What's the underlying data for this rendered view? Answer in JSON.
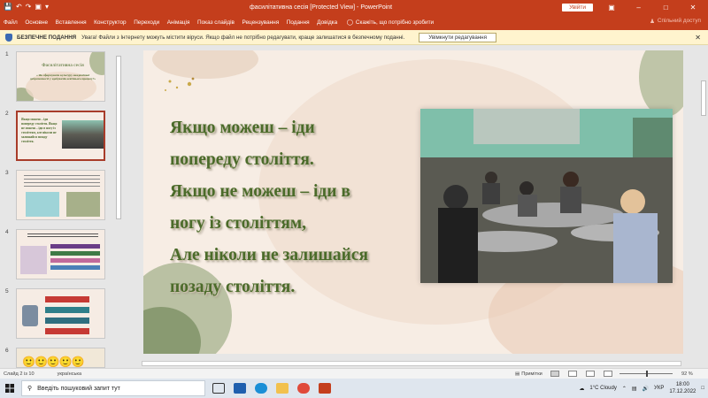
{
  "titlebar": {
    "title": "фасилітативна сесія [Protected View]  -  PowerPoint",
    "signin": "Увійти",
    "save_icon": "save-icon",
    "undo_icon": "undo-icon",
    "redo_icon": "redo-icon",
    "start_icon": "present-icon",
    "customize_icon": "customize-icon"
  },
  "ribbon": {
    "tabs": [
      "Файл",
      "Основне",
      "Вставлення",
      "Конструктор",
      "Переходи",
      "Анімація",
      "Показ слайдів",
      "Рецензування",
      "Подання",
      "Довідка"
    ],
    "tell_me": "Скажіть, що потрібно зробити",
    "share": "Спільний доступ"
  },
  "protected": {
    "title": "БЕЗПЕЧНЕ ПОДАННЯ",
    "message": "Увага! Файли з Інтернету можуть містити віруси. Якщо файл не потрібно редагувати, краще залишатися в безпечному поданні.",
    "button": "Увімкнути редагування"
  },
  "thumbnails": [
    {
      "num": "1",
      "title": "Фасилітативна сесія",
      "sub": "« Як сформувати культуру академічної доброчесності у здобувачів освітнього процесу?»"
    },
    {
      "num": "2",
      "text": "Якщо можеш – іди попереду століття. Якщо не можеш – іди в ногу із століттям, але ніколи не залишайся позаду століття."
    },
    {
      "num": "3",
      "text": ""
    },
    {
      "num": "4",
      "text": ""
    },
    {
      "num": "5",
      "text": ""
    },
    {
      "num": "6",
      "text": ""
    }
  ],
  "slide": {
    "lines": [
      "Якщо можеш – іди",
      "попереду століття.",
      "Якщо не можеш – іди в",
      "ногу із століттям,",
      "Але ніколи не залишайся",
      "позаду століття."
    ]
  },
  "status": {
    "slide_of": "Слайд 2 із 10",
    "language": "українська",
    "notes": "Примітки",
    "zoom": "92 %"
  },
  "taskbar": {
    "search_placeholder": "Введіть пошуковий запит тут",
    "weather": "1°C  Cloudy",
    "lang": "УКР",
    "time": "18:00",
    "date": "17.12.2022"
  },
  "colors": {
    "accent": "#c43e1c",
    "slide_text": "#4b6b2a",
    "slide_bg": "#f7ede4",
    "warning_bar": "#fff4ce"
  }
}
